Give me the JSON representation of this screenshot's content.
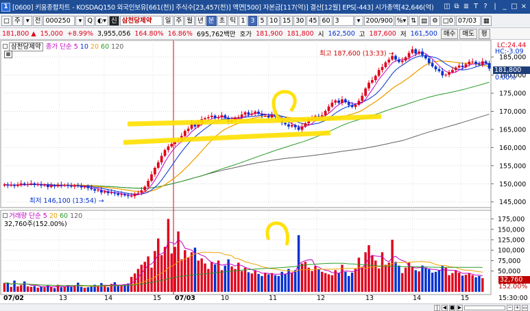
{
  "window": {
    "app_number": "1",
    "title": "[0600] 키움종합차트 - KOSDAQ150 외국인보유[661(천)] 주식수[23,457(천)] 액면[500] 자본금[117(억)] 결산[12월] EPS[-443] 시가총액[42,646(억)",
    "controls": [
      "◫",
      "⧉",
      "≣",
      "T",
      "?",
      "|",
      "_",
      "□",
      "×"
    ]
  },
  "toolbar": {
    "buttons_left": [
      "□",
      "주",
      "▾",
      "전"
    ],
    "code": "000250",
    "search_buttons": [
      "▾",
      "Q",
      "◐▾"
    ],
    "badge": "신",
    "stock_name": "삼천당제약",
    "periods": [
      "일",
      "주",
      "월",
      "년",
      "분",
      "초",
      "틱",
      "1",
      "3",
      "5",
      "10",
      "15",
      "30",
      "45",
      "60"
    ],
    "selected_period": "분",
    "selected_interval": "3",
    "interval": "3",
    "count": "200/900",
    "tools": [
      "%▾",
      "⇅",
      "▤",
      "⚙"
    ],
    "date_checkbox": "□0",
    "date": "07/03"
  },
  "quote": {
    "price": "181,800",
    "change": "15,000",
    "change_pct": "+8.99%",
    "volume": "3,955,056",
    "volume_ratio": "164.80%",
    "turnover": "16.86%",
    "amount": "695,762백만",
    "bid_label": "호가",
    "bid": "181,900",
    "ask": "181,800",
    "open_label": "시",
    "open": "162,500",
    "high_label": "고",
    "high": "187,600",
    "low_label": "저",
    "low": "161,500",
    "buy_button": "매수",
    "sell_button": "매도",
    "avg_button": "평"
  },
  "price_panel": {
    "stock_label": "삼천당제약",
    "indicator_label": "종가 단순",
    "ma_periods": [
      "5",
      "10",
      "20",
      "60",
      "120"
    ],
    "lc_label": "LC:24.44",
    "hc_label": "HC:-3.09",
    "current_price_tag": "181,800",
    "current_pct_tag": "0.00%",
    "high_annotation": "최고 187,600 (13:33)",
    "low_annotation": "최저 146,100 (13:54)"
  },
  "volume_panel": {
    "label": "거래량 단순",
    "ma_periods": [
      "5",
      "20",
      "60",
      "120"
    ],
    "current_volume_text": "32,760주(152.00%)",
    "current_volume_tag": "32,760",
    "current_volume_pct_tag": "152.00%"
  },
  "time_axis": {
    "labels": [
      "07/02",
      "13",
      "14",
      "15",
      "07/03",
      "10",
      "11",
      "12",
      "13",
      "14",
      "15"
    ],
    "current_time": "15:30:00"
  },
  "colors": {
    "up": "#e0001b",
    "down": "#0030d0",
    "ma5": "#c000c0",
    "ma10": "#0030d0",
    "ma20": "#f0a000",
    "ma60": "#2a9a2a",
    "ma120": "#606060",
    "highlight": "#ffe000"
  },
  "chart_data": [
    {
      "type": "candlestick",
      "title": "삼천당제약",
      "ylim": [
        144000,
        189000
      ],
      "y_ticks": [
        145000,
        150000,
        155000,
        160000,
        165000,
        170000,
        175000,
        180000,
        185000
      ],
      "grid": true,
      "open": [
        149500,
        149800,
        149500,
        149700,
        149400,
        149800,
        150100,
        149800,
        149900,
        150100,
        149700,
        149800,
        149500,
        149700,
        149100,
        149500,
        149300,
        149700,
        149500,
        149700,
        149400,
        149200,
        149600,
        149300,
        149000,
        149200,
        148800,
        148500,
        148100,
        148200,
        147600,
        147900,
        147400,
        147600,
        147300,
        146900,
        147100,
        146800,
        146600,
        146600,
        147300,
        147500,
        148200,
        149200,
        150800,
        152600,
        154400,
        155900,
        157700,
        159300,
        160300,
        161000,
        161700,
        162100,
        163200,
        164600,
        165200,
        166700,
        165800,
        166700,
        167800,
        168100,
        168400,
        168800,
        168100,
        168300,
        168900,
        168200,
        167100,
        167600,
        168300,
        168400,
        169100,
        169700,
        169100,
        169400,
        169900,
        169300,
        168800,
        168800,
        168300,
        169000,
        168500,
        167700,
        166800,
        166400,
        165800,
        166200,
        165600,
        164900,
        165800,
        166700,
        167700,
        168000,
        168700,
        168300,
        168900,
        170100,
        171300,
        172400,
        173000,
        172300,
        173300,
        172500,
        171700,
        171200,
        171800,
        172900,
        174300,
        176300,
        177900,
        178600,
        179800,
        181400,
        182200,
        183500,
        184300,
        185300,
        184300,
        183600,
        184000,
        184900,
        186100,
        187100,
        185900,
        186500,
        185500,
        184600,
        183300,
        182400,
        181600,
        181100,
        179900,
        180100,
        180800,
        181400,
        182100,
        182600,
        182200,
        183000,
        183700,
        183700,
        183100,
        182900,
        183800,
        183300
      ],
      "close": [
        149800,
        149500,
        149700,
        149400,
        149800,
        150100,
        149800,
        149900,
        150100,
        149700,
        149800,
        149500,
        149700,
        149100,
        149500,
        149300,
        149700,
        149500,
        149700,
        149400,
        149200,
        149600,
        149300,
        149000,
        149200,
        148800,
        148500,
        148100,
        148200,
        147600,
        147900,
        147400,
        147600,
        147300,
        146900,
        147100,
        146800,
        146600,
        146600,
        147300,
        147500,
        148200,
        149200,
        150800,
        152600,
        154400,
        155900,
        157700,
        159300,
        160300,
        161000,
        161700,
        162100,
        163200,
        164600,
        165200,
        166700,
        165800,
        166700,
        167800,
        168100,
        168400,
        168800,
        168100,
        168300,
        168900,
        168200,
        167100,
        167600,
        168300,
        168400,
        169100,
        169700,
        169100,
        169400,
        169900,
        169300,
        168800,
        168800,
        168300,
        169000,
        168500,
        167700,
        166800,
        166400,
        165800,
        166200,
        165600,
        164900,
        165800,
        166700,
        167700,
        168000,
        168700,
        168300,
        168900,
        170100,
        171300,
        172400,
        173000,
        172300,
        173300,
        172500,
        171700,
        171200,
        171800,
        172900,
        174300,
        176300,
        177900,
        178600,
        179800,
        181400,
        182200,
        183500,
        184300,
        185300,
        184300,
        183600,
        184000,
        184900,
        186100,
        187100,
        185900,
        186500,
        185500,
        184600,
        183300,
        182400,
        181600,
        181100,
        179900,
        180100,
        180800,
        181400,
        182100,
        182600,
        182200,
        183000,
        183700,
        183700,
        183100,
        182900,
        183800,
        183300,
        181800
      ],
      "high_marker": {
        "label": "최고 187,600 (13:33)",
        "value": 187600
      },
      "low_marker": {
        "label": "최저 146,100 (13:54)",
        "value": 146100
      }
    },
    {
      "type": "bar",
      "title": "거래량",
      "ylim": [
        0,
        187500
      ],
      "y_ticks": [
        50000,
        75000,
        100000,
        125000,
        150000,
        175000
      ],
      "grid": true,
      "values": [
        21000,
        22000,
        12000,
        27000,
        13000,
        16000,
        25000,
        13000,
        12000,
        14000,
        10000,
        13000,
        11000,
        15000,
        12000,
        9000,
        17000,
        11000,
        12000,
        16000,
        12000,
        16000,
        22000,
        12000,
        10000,
        11000,
        13000,
        17000,
        15000,
        21000,
        14000,
        11000,
        19000,
        23000,
        14000,
        15000,
        17000,
        20000,
        36000,
        44000,
        55000,
        65000,
        72000,
        85000,
        58000,
        98000,
        128000,
        88000,
        108000,
        175000,
        92000,
        108000,
        145000,
        78000,
        100000,
        82000,
        95000,
        106000,
        75000,
        80000,
        68000,
        55000,
        72000,
        66000,
        75000,
        52000,
        63000,
        78000,
        61000,
        55000,
        70000,
        50000,
        58000,
        47000,
        44000,
        52000,
        43000,
        38000,
        46000,
        42000,
        45000,
        40000,
        38000,
        48000,
        42000,
        55000,
        46000,
        52000,
        136000,
        68000,
        72000,
        58000,
        50000,
        62000,
        55000,
        48000,
        45000,
        42000,
        40000,
        52000,
        45000,
        65000,
        48000,
        38000,
        46000,
        55000,
        82000,
        60000,
        95000,
        112000,
        88000,
        75000,
        56000,
        95000,
        65000,
        70000,
        125000,
        72000,
        63000,
        45000,
        58000,
        70000,
        61000,
        52000,
        49000,
        63000,
        58000,
        54000,
        46000,
        48000,
        52000,
        62000,
        58000,
        40000,
        45000,
        52000,
        46000,
        39000,
        41000,
        45000,
        40000,
        35000,
        38000,
        32760
      ]
    }
  ]
}
